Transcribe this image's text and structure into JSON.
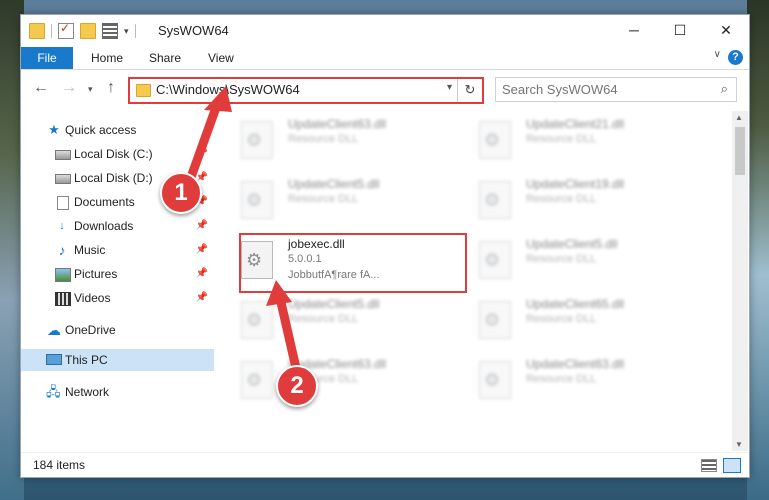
{
  "titlebar": {
    "title": "SysWOW64",
    "minimize_label": "─",
    "maximize_label": "☐",
    "close_label": "✕"
  },
  "ribbon": {
    "tabs": [
      "File",
      "Home",
      "Share",
      "View"
    ]
  },
  "address": {
    "path": "C:\\Windows\\SysWOW64",
    "search_placeholder": "Search SysWOW64"
  },
  "navpane": {
    "items": [
      {
        "label": "Quick access",
        "icon": "star-icon",
        "pinned": false
      },
      {
        "label": "Local Disk (C:)",
        "icon": "disk-icon",
        "pinned": true
      },
      {
        "label": "Local Disk (D:)",
        "icon": "disk-icon",
        "pinned": true
      },
      {
        "label": "Documents",
        "icon": "documents-icon",
        "pinned": true
      },
      {
        "label": "Downloads",
        "icon": "download-icon",
        "pinned": true
      },
      {
        "label": "Music",
        "icon": "music-icon",
        "pinned": true
      },
      {
        "label": "Pictures",
        "icon": "pictures-icon",
        "pinned": true
      },
      {
        "label": "Videos",
        "icon": "videos-icon",
        "pinned": true
      },
      {
        "label": "OneDrive",
        "icon": "onedrive-icon",
        "pinned": false
      },
      {
        "label": "This PC",
        "icon": "pc-icon",
        "pinned": false,
        "selected": true
      },
      {
        "label": "Network",
        "icon": "network-icon",
        "pinned": false
      }
    ]
  },
  "files": [
    {
      "name": "UpdateClient63.dll",
      "desc": "Resource DLL"
    },
    {
      "name": "UpdateClient21.dll",
      "desc": "Resource DLL"
    },
    {
      "name": "UpdateClient5.dll",
      "desc": "Resource DLL"
    },
    {
      "name": "UpdateClient19.dll",
      "desc": "Resource DLL"
    },
    {
      "name": "jobexec.dll",
      "version": "5.0.0.1",
      "desc": "JobbutfA¶rare fA..."
    },
    {
      "name": "UpdateClient5.dll",
      "desc": "Resource DLL"
    },
    {
      "name": "UpdateClient5.dll",
      "desc": "Resource DLL"
    },
    {
      "name": "UpdateClient65.dll",
      "desc": "Resource DLL"
    },
    {
      "name": "UpdateClient63.dll",
      "desc": "Resource DLL"
    },
    {
      "name": "UpdateClient63.dll",
      "desc": "Resource DLL"
    }
  ],
  "status": {
    "item_count": "184 items"
  },
  "annotations": {
    "step1": "1",
    "step2": "2",
    "color": "#e03c3c"
  }
}
